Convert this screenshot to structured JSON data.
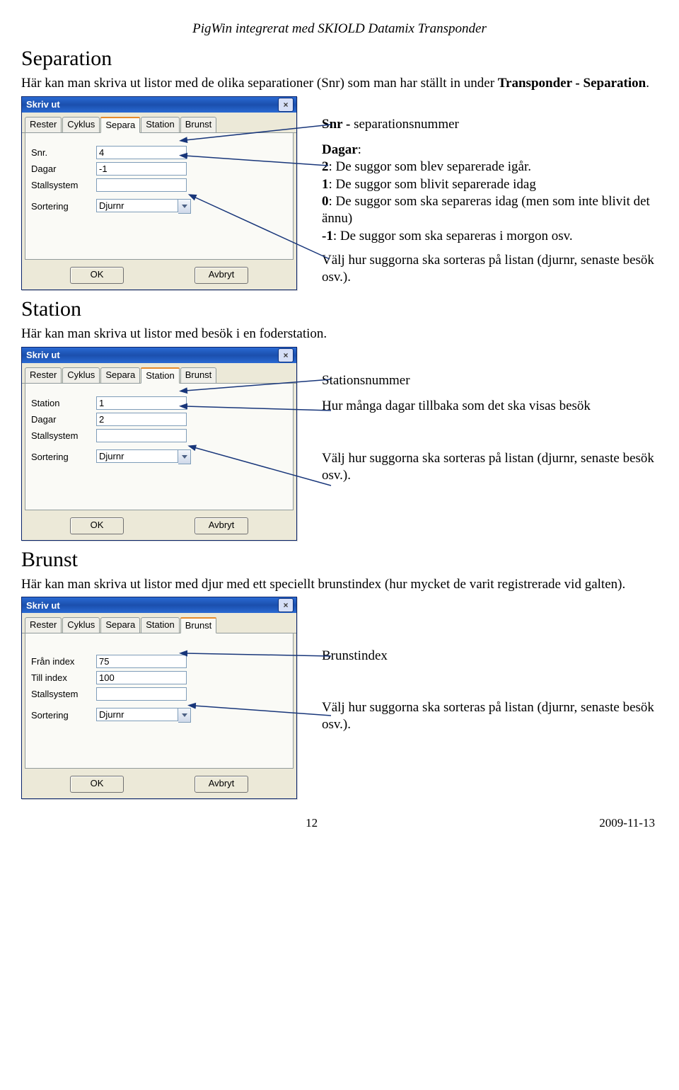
{
  "page": {
    "header_italic": "PigWin integrerat med SKIOLD Datamix Transponder",
    "number": "12",
    "date": "2009-11-13"
  },
  "sections": {
    "separation": {
      "title": "Separation",
      "intro_plain": "Här kan man skriva ut listor med de olika separationer (Snr) som man har ställt in under ",
      "intro_bold": "Transponder - Separation",
      "period": ".",
      "snr_label": "Snr -",
      "snr_desc": "separationsnummer",
      "dagar_label": "Dagar",
      "dagar_colon": ":",
      "dagar2b": "2",
      "dagar2t": ": De suggor som blev separerade igår.",
      "dagar1b": "1",
      "dagar1t": ": De suggor som blivit separerade idag",
      "dagar0b": "0",
      "dagar0t": ": De suggor som ska separeras idag (men som inte blivit det ännu)",
      "dagarmb": "-1",
      "dagarmt": ": De suggor som ska separeras i morgon osv.",
      "sort_text": "Välj hur suggorna ska sorteras på listan (djurnr, senaste besök osv.)."
    },
    "station": {
      "title": "Station",
      "intro": "Här kan man skriva ut listor med besök i en foderstation.",
      "anno1": "Stationsnummer",
      "anno2": "Hur många dagar tillbaka som det ska visas besök",
      "sort_text": "Välj hur suggorna ska sorteras på listan (djurnr, senaste besök osv.)."
    },
    "brunst": {
      "title": "Brunst",
      "intro": "Här kan man skriva ut listor med djur med ett speciellt brunstindex (hur mycket de varit registrerade vid galten).",
      "anno1": "Brunstindex",
      "sort_text": "Välj hur suggorna ska sorteras på listan (djurnr, senaste besök osv.)."
    }
  },
  "dialog": {
    "title": "Skriv ut",
    "tabs": {
      "t0": "Rester",
      "t1": "Cyklus",
      "t2": "Separa",
      "t3": "Station",
      "t4": "Brunst"
    },
    "labels": {
      "snr": "Snr.",
      "dagar": "Dagar",
      "stall": "Stallsystem",
      "sort": "Sortering",
      "station": "Station",
      "fran": "Från index",
      "till": "Till index"
    },
    "values": {
      "snr": "4",
      "dagar_sep": "-1",
      "sort_val": "Djurnr",
      "station": "1",
      "dagar_sta": "2",
      "fran": "75",
      "till": "100"
    },
    "buttons": {
      "ok": "OK",
      "cancel": "Avbryt"
    }
  }
}
